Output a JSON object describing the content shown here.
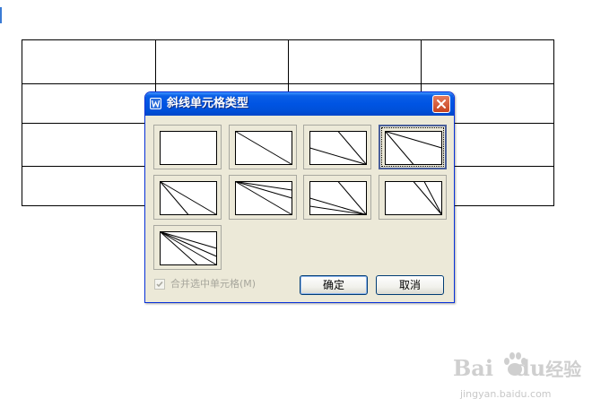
{
  "dialog": {
    "title": "斜线单元格类型",
    "options": [
      {
        "id": "none"
      },
      {
        "id": "single-diagonal"
      },
      {
        "id": "two-lines-top-right"
      },
      {
        "id": "two-lines-top-left",
        "selected": true
      },
      {
        "id": "two-lines-variant-a"
      },
      {
        "id": "three-lines-variant-b"
      },
      {
        "id": "three-lines-variant-c"
      },
      {
        "id": "two-lines-variant-d"
      },
      {
        "id": "four-lines-fan"
      }
    ],
    "merge_checkbox": {
      "label": "合并选中单元格(M)",
      "checked": true,
      "enabled": false
    },
    "ok_label": "确定",
    "cancel_label": "取消"
  },
  "watermark": {
    "logo_text": "Bai",
    "logo_cn": "经验",
    "logo_du": "du",
    "url": "jingyan.baidu.com"
  },
  "colors": {
    "title_bar": "#0054e3",
    "dialog_bg": "#ece9d8",
    "close_button": "#d2522e"
  }
}
